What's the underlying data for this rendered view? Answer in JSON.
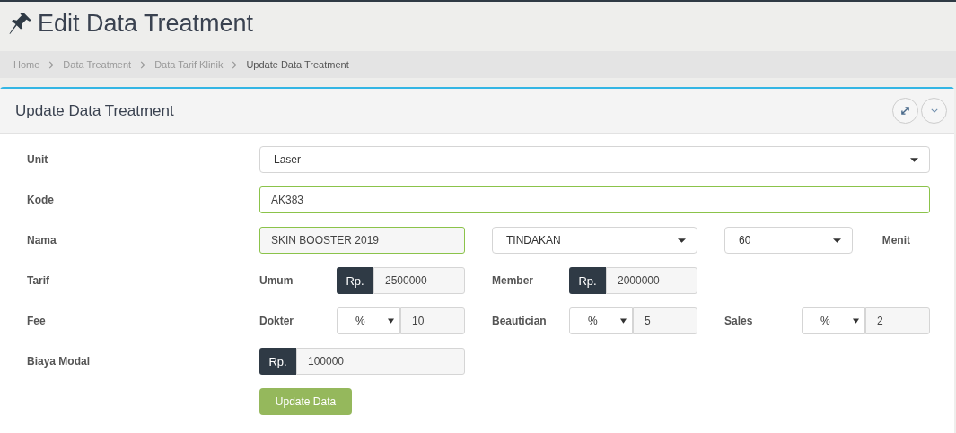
{
  "page_title": "Edit Data Treatment",
  "breadcrumb": [
    {
      "label": "Home",
      "current": false
    },
    {
      "label": "Data Treatment",
      "current": false
    },
    {
      "label": "Data Tarif Klinik",
      "current": false
    },
    {
      "label": "Update Data Treatment",
      "current": true
    }
  ],
  "panel": {
    "title": "Update Data Treatment"
  },
  "form": {
    "unit": {
      "label": "Unit",
      "value": "Laser"
    },
    "kode": {
      "label": "Kode",
      "value": "AK383",
      "valid": true
    },
    "nama": {
      "label": "Nama",
      "value": "SKIN BOOSTER 2019",
      "valid": true,
      "kategori": "TINDAKAN",
      "durasi": "60",
      "durasi_unit": "Menit"
    },
    "tarif": {
      "label": "Tarif",
      "items": [
        {
          "label": "Umum",
          "prefix": "Rp.",
          "value": "2500000"
        },
        {
          "label": "Member",
          "prefix": "Rp.",
          "value": "2000000"
        }
      ]
    },
    "fee": {
      "label": "Fee",
      "items": [
        {
          "label": "Dokter",
          "type": "%",
          "value": "10"
        },
        {
          "label": "Beautician",
          "type": "%",
          "value": "5"
        },
        {
          "label": "Sales",
          "type": "%",
          "value": "2"
        }
      ]
    },
    "biaya_modal": {
      "label": "Biaya Modal",
      "prefix": "Rp.",
      "value": "100000"
    },
    "submit": "Update Data"
  }
}
